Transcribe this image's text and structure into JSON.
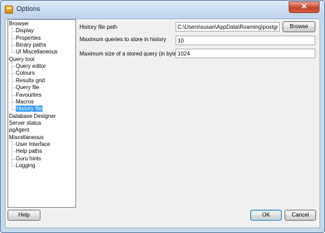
{
  "window": {
    "title": "Options",
    "close_glyph": "✕"
  },
  "tree": {
    "items": [
      {
        "label": "Browser",
        "level": 0
      },
      {
        "label": "Display",
        "level": 1
      },
      {
        "label": "Properties",
        "level": 1
      },
      {
        "label": "Binary paths",
        "level": 1
      },
      {
        "label": "UI Miscellaneous",
        "level": 1
      },
      {
        "label": "Query tool",
        "level": 0
      },
      {
        "label": "Query editor",
        "level": 1
      },
      {
        "label": "Colours",
        "level": 1
      },
      {
        "label": "Results grid",
        "level": 1
      },
      {
        "label": "Query file",
        "level": 1
      },
      {
        "label": "Favourites",
        "level": 1
      },
      {
        "label": "Macros",
        "level": 1
      },
      {
        "label": "History file",
        "level": 1,
        "selected": true
      },
      {
        "label": "Database Designer",
        "level": 0
      },
      {
        "label": "Server status",
        "level": 0
      },
      {
        "label": "pgAgent",
        "level": 0
      },
      {
        "label": "Miscellaneous",
        "level": 0
      },
      {
        "label": "User Interface",
        "level": 1
      },
      {
        "label": "Help paths",
        "level": 1
      },
      {
        "label": "Guru hints",
        "level": 1
      },
      {
        "label": "Logging",
        "level": 1
      }
    ]
  },
  "settings": {
    "history_path_label": "History file path",
    "history_path_value": "C:\\Users\\susan\\AppData\\Roaming\\postgresql\\pgadmin_histoqueries.xml",
    "browse_label": "Browse",
    "max_queries_label": "Maximum queries to store in history",
    "max_queries_value": "10",
    "max_size_label": "Maximum size of a stored query (in bytes)",
    "max_size_value": "1024"
  },
  "buttons": {
    "help": "Help",
    "ok": "OK",
    "cancel": "Cancel"
  }
}
